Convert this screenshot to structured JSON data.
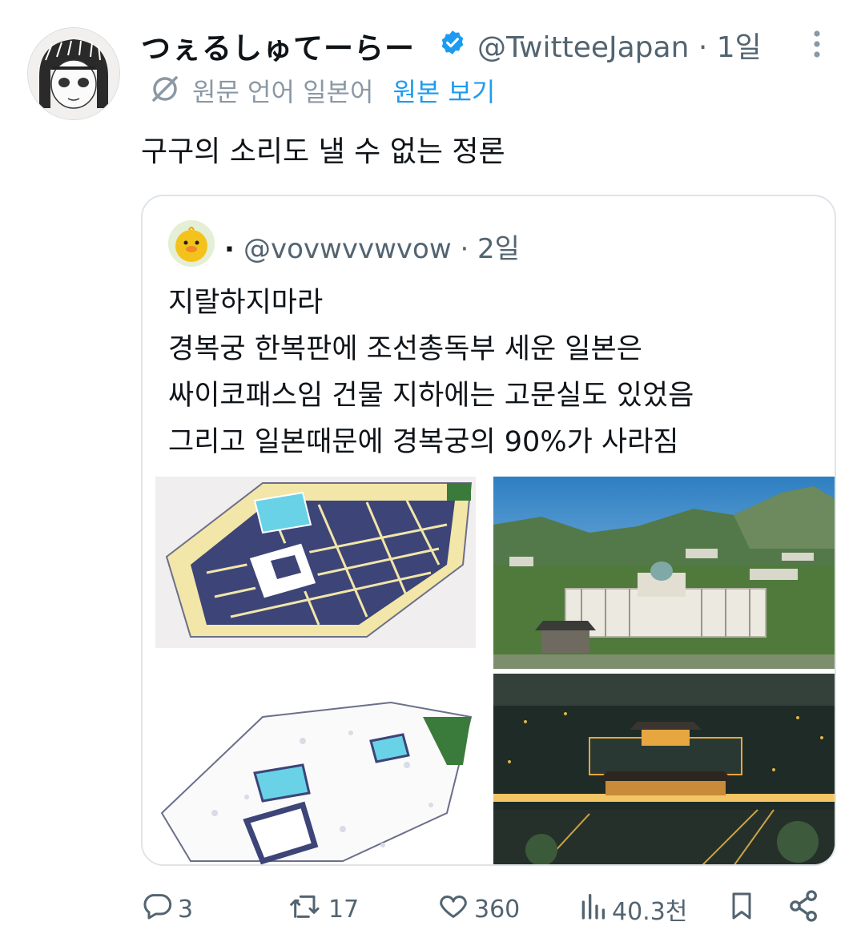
{
  "author": {
    "display_name": "つぇるしゅてーらー",
    "handle_time": "@TwitteeJapan · 1일"
  },
  "translation": {
    "lang_label": "원문 언어 일본어",
    "show_original": "원본 보기"
  },
  "tweet_text": "구구의 소리도 낼 수 없는 정론",
  "quote": {
    "display_name": ".",
    "handle_time": "@vovwvvwvow · 2일",
    "lines": [
      "지랄하지마라",
      "경복궁 한복판에 조선총독부 세운 일본은",
      "싸이코패스임 건물 지하에는 고문실도 있었음",
      "그리고 일본때문에 경복궁의 90%가 사라짐"
    ]
  },
  "actions": {
    "replies": "3",
    "retweets": "17",
    "likes": "360",
    "views": "40.3천"
  },
  "colors": {
    "verified": "#1d9bf0",
    "link": "#1d9bf0",
    "muted": "#536471"
  }
}
